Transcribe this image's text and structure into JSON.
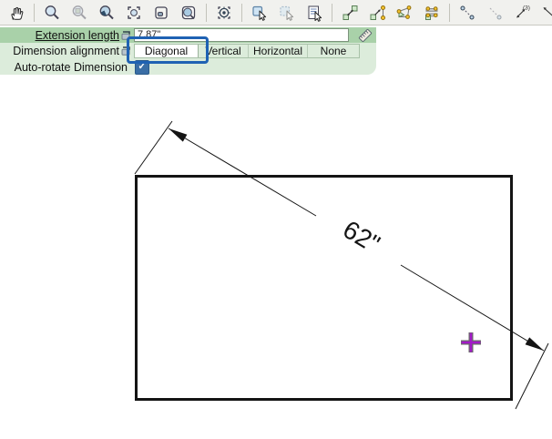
{
  "colors": {
    "row1_bg": "#a9d1a9",
    "row2_bg": "#dcecdb",
    "focus_ring_blue": "#1f62b3",
    "checkbox_blue": "#3a6ea5",
    "cursor_purple": "#a319c8"
  },
  "toolbar": {
    "items": [
      {
        "icon": "pan-tool"
      },
      {
        "type": "sep"
      },
      {
        "icon": "zoom-tool"
      },
      {
        "icon": "zoom-disabled-tool",
        "disabled": true
      },
      {
        "icon": "undo-zoom-tool"
      },
      {
        "icon": "fill-window-tool"
      },
      {
        "icon": "zoom-box-tool"
      },
      {
        "icon": "zoom-region-tool"
      },
      {
        "type": "sep"
      },
      {
        "icon": "center-view-tool"
      },
      {
        "type": "sep"
      },
      {
        "icon": "select-objects-tool"
      },
      {
        "icon": "similar-objects-tool",
        "disabled": true
      },
      {
        "icon": "open-object-tool"
      },
      {
        "type": "sep"
      },
      {
        "icon": "transform-replicate-tool"
      },
      {
        "icon": "resize-tool"
      },
      {
        "icon": "edit-polyline-tool"
      },
      {
        "icon": "edit-handles-tool"
      },
      {
        "type": "sep"
      },
      {
        "icon": "point-to-point-dimension-tool"
      },
      {
        "icon": "interior-dimension-tool",
        "disabled": true
      },
      {
        "icon": "auto-dimension-tool",
        "badge": "(3)"
      },
      {
        "icon": "manual-dimension-tool"
      },
      {
        "type": "sep"
      },
      {
        "icon": "ruler-tool"
      }
    ]
  },
  "panel": {
    "extension_length": {
      "label": "Extension length",
      "value": "7.87\""
    },
    "alignment": {
      "label": "Dimension alignment",
      "options": [
        "Diagonal",
        "Vertical",
        "Horizontal",
        "None"
      ],
      "selected": "Diagonal"
    },
    "auto_rotate": {
      "label": "Auto-rotate Dimension",
      "checked": true,
      "check_glyph": "✓"
    }
  },
  "drawing": {
    "dimension_label": "62\""
  }
}
